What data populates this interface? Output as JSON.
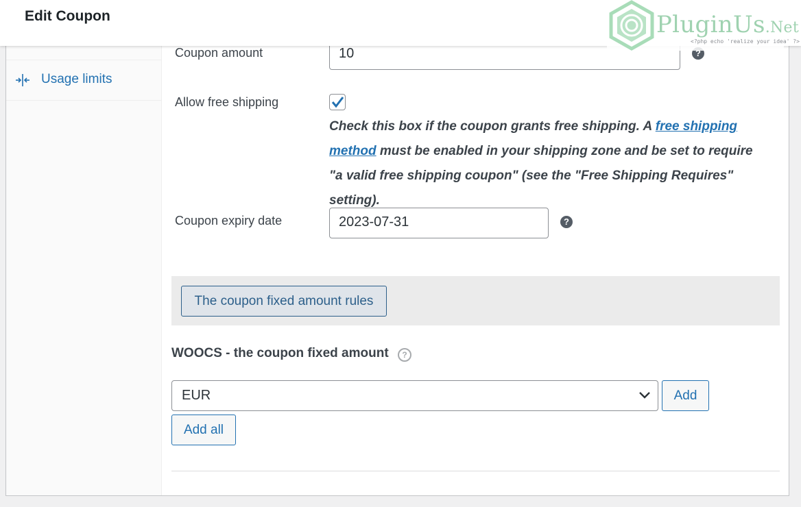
{
  "header": {
    "title": "Edit Coupon"
  },
  "logo": {
    "brand": "PluginUs",
    "suffix": ".Net",
    "tagline": "<?php echo 'realize your idea' ?>"
  },
  "sidebar": {
    "items": [
      {
        "label": "Usage limits",
        "icon": "usage-limits-icon"
      }
    ]
  },
  "form": {
    "coupon_amount": {
      "label": "Coupon amount",
      "value": "10"
    },
    "free_shipping": {
      "label": "Allow free shipping",
      "checked": true,
      "desc_before": "Check this box if the coupon grants free shipping. A ",
      "desc_link": "free shipping method",
      "desc_after": " must be enabled in your shipping zone and be set to require \"a valid free shipping coupon\" (see the \"Free Shipping Requires\" setting)."
    },
    "expiry_date": {
      "label": "Coupon expiry date",
      "value": "2023-07-31"
    }
  },
  "woocs": {
    "rules_button": "The coupon fixed amount rules",
    "section_title": "WOOCS - the coupon fixed amount",
    "currency_selected": "EUR",
    "add_button": "Add",
    "add_all_button": "Add all"
  },
  "colors": {
    "accent": "#2271b1",
    "logo_green": "#9fd2b0",
    "band": "#ebebeb"
  }
}
